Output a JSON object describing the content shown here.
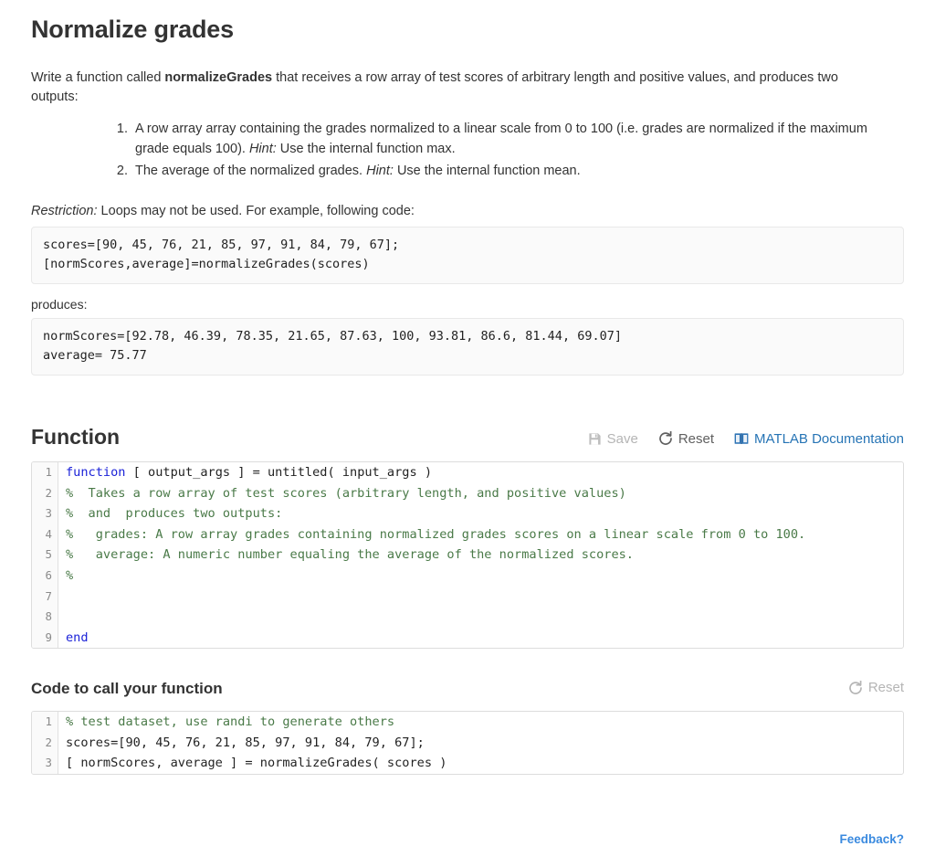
{
  "problem": {
    "title": "Normalize grades",
    "intro_before": "Write a function called ",
    "intro_bold": "normalizeGrades",
    "intro_after": " that receives a row array of test scores of arbitrary length and positive values, and produces two outputs:",
    "outputs": [
      {
        "text_before_hint": "A row array array containing the grades normalized to a linear scale from 0 to 100 (i.e. grades are normalized if the maximum grade equals 100). ",
        "hint_label": "Hint:",
        "text_after_hint": " Use the internal function max."
      },
      {
        "text_before_hint": "The average of the normalized grades. ",
        "hint_label": "Hint:",
        "text_after_hint": " Use the internal function mean."
      }
    ],
    "restriction_label": "Restriction:",
    "restriction_text": " Loops may not be used. For example, following code:",
    "example_code": "scores=[90, 45, 76, 21, 85, 97, 91, 84, 79, 67];\n[normScores,average]=normalizeGrades(scores)",
    "produces_label": "produces:",
    "example_output": "normScores=[92.78, 46.39, 78.35, 21.65, 87.63, 100, 93.81, 86.6, 81.44, 69.07]\naverage= 75.77"
  },
  "function_section": {
    "heading": "Function",
    "toolbar": {
      "save_label": "Save",
      "save_icon": "floppy-disk-icon",
      "reset_label": "Reset",
      "reset_icon": "refresh-icon",
      "docs_label": "MATLAB Documentation",
      "docs_icon": "book-icon"
    },
    "editor_lines": [
      {
        "n": "1",
        "tokens": [
          {
            "t": "kw",
            "s": "function"
          },
          {
            "t": "txt",
            "s": " [ output_args ] = untitled( input_args )"
          }
        ]
      },
      {
        "n": "2",
        "tokens": [
          {
            "t": "cmt",
            "s": "%  Takes a row array of test scores (arbitrary length, and positive values)"
          }
        ]
      },
      {
        "n": "3",
        "tokens": [
          {
            "t": "cmt",
            "s": "%  and  produces two outputs:"
          }
        ]
      },
      {
        "n": "4",
        "tokens": [
          {
            "t": "cmt",
            "s": "%   grades: A row array grades containing normalized grades scores on a linear scale from 0 to 100."
          }
        ]
      },
      {
        "n": "5",
        "tokens": [
          {
            "t": "cmt",
            "s": "%   average: A numeric number equaling the average of the normalized scores."
          }
        ]
      },
      {
        "n": "6",
        "tokens": [
          {
            "t": "cmt",
            "s": "%"
          }
        ]
      },
      {
        "n": "7",
        "tokens": [
          {
            "t": "txt",
            "s": ""
          }
        ]
      },
      {
        "n": "8",
        "tokens": [
          {
            "t": "txt",
            "s": ""
          }
        ]
      },
      {
        "n": "9",
        "tokens": [
          {
            "t": "kw",
            "s": "end"
          }
        ]
      }
    ]
  },
  "call_section": {
    "heading": "Code to call your function",
    "toolbar": {
      "reset_label": "Reset",
      "reset_icon": "refresh-icon"
    },
    "editor_lines": [
      {
        "n": "1",
        "tokens": [
          {
            "t": "cmt",
            "s": "% test dataset, use randi to generate others"
          }
        ]
      },
      {
        "n": "2",
        "tokens": [
          {
            "t": "txt",
            "s": "scores=[90, 45, 76, 21, 85, 97, 91, 84, 79, 67];"
          }
        ]
      },
      {
        "n": "3",
        "tokens": [
          {
            "t": "txt",
            "s": "[ normScores, average ] = normalizeGrades( scores )"
          }
        ]
      }
    ]
  },
  "feedback": {
    "label": "Feedback?"
  },
  "colors": {
    "link": "#2674b5",
    "feedback": "#3a8adf",
    "keyword": "#1b22d8",
    "comment": "#4a7a48",
    "text": "#333333",
    "disabled": "#b5b5b5"
  }
}
